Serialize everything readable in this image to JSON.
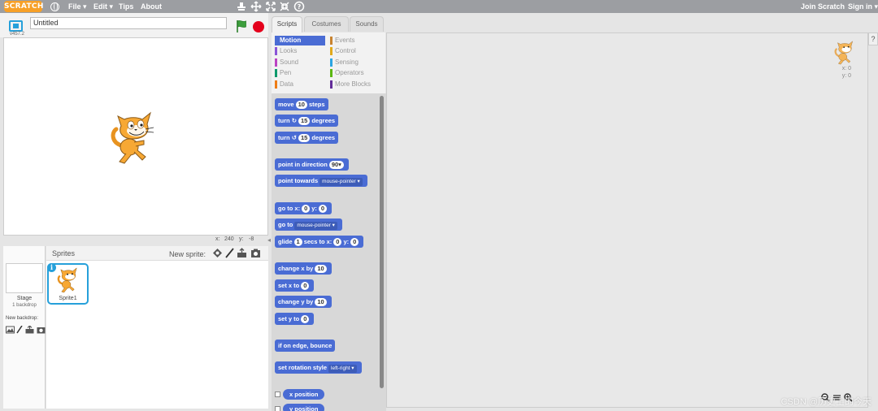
{
  "menubar": {
    "logo": "SCRATCH",
    "file": "File ▾",
    "edit": "Edit ▾",
    "tips": "Tips",
    "about": "About",
    "join": "Join Scratch",
    "signin": "Sign in ▾"
  },
  "stage": {
    "version": "v457.2",
    "title": "Untitled",
    "x_label": "x:",
    "x_value": "240",
    "y_label": "y:",
    "y_value": "-8"
  },
  "sprites": {
    "title": "Sprites",
    "new_sprite": "New sprite:",
    "stage_label": "Stage",
    "backdrop_count": "1 backdrop",
    "new_backdrop": "New backdrop:",
    "sprite1": "Sprite1"
  },
  "tabs": [
    "Scripts",
    "Costumes",
    "Sounds"
  ],
  "categories": [
    {
      "label": "Motion",
      "color": "#4a6cd4"
    },
    {
      "label": "Looks",
      "color": "#8a55d7"
    },
    {
      "label": "Sound",
      "color": "#bb42c3"
    },
    {
      "label": "Pen",
      "color": "#0e9a6c"
    },
    {
      "label": "Data",
      "color": "#ee7d16"
    },
    {
      "label": "Events",
      "color": "#c88330"
    },
    {
      "label": "Control",
      "color": "#e1a91a"
    },
    {
      "label": "Sensing",
      "color": "#2ca5e2"
    },
    {
      "label": "Operators",
      "color": "#5cb712"
    },
    {
      "label": "More Blocks",
      "color": "#632d99"
    }
  ],
  "blocks": {
    "move_a": "move",
    "move_n": "10",
    "move_b": "steps",
    "turn_cw_a": "turn",
    "turn_cw_n": "15",
    "turn_cw_b": "degrees",
    "turn_ccw_a": "turn",
    "turn_ccw_n": "15",
    "turn_ccw_b": "degrees",
    "point_dir_a": "point in direction",
    "point_dir_n": "90▾",
    "point_towards_a": "point towards",
    "point_towards_dd": "mouse-pointer ▾",
    "goto_xy_a": "go to x:",
    "goto_xy_x": "0",
    "goto_xy_b": "y:",
    "goto_xy_y": "0",
    "goto_a": "go to",
    "goto_dd": "mouse-pointer ▾",
    "glide_a": "glide",
    "glide_n": "1",
    "glide_b": "secs to x:",
    "glide_x": "0",
    "glide_c": "y:",
    "glide_y": "0",
    "change_x_a": "change x by",
    "change_x_n": "10",
    "set_x_a": "set x to",
    "set_x_n": "0",
    "change_y_a": "change y by",
    "change_y_n": "10",
    "set_y_a": "set y to",
    "set_y_n": "0",
    "bounce": "if on edge, bounce",
    "rotation_a": "set rotation style",
    "rotation_dd": "left-right ▾",
    "x_position": "x position",
    "y_position": "y position"
  },
  "script_area": {
    "x_coord": "x: 0",
    "y_coord": "y: 0",
    "help": "?"
  },
  "watermark": "CSDN @历史上的今天"
}
